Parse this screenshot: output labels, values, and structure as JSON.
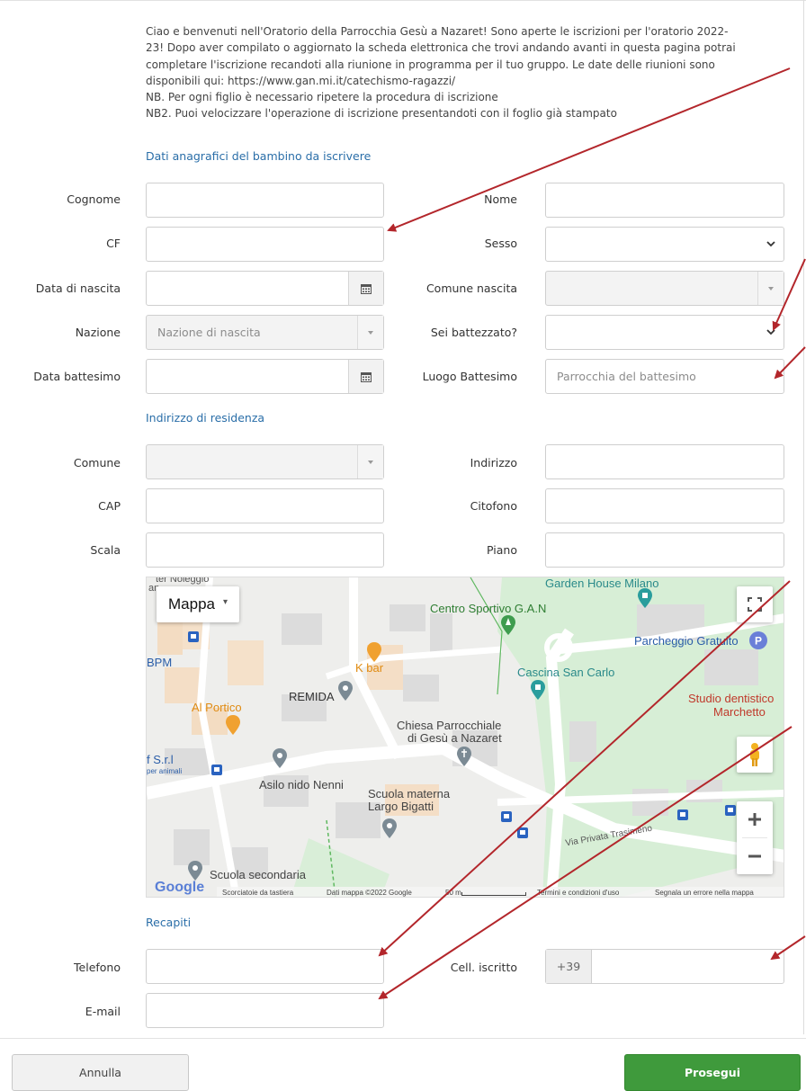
{
  "intro": {
    "lines": [
      "Ciao e benvenuti nell'Oratorio della Parrocchia Gesù a Nazaret! Sono aperte le iscrizioni per l'oratorio 2022-",
      "23! Dopo aver compilato o aggiornato la scheda elettronica che trovi andando avanti in questa pagina potrai",
      "completare l'iscrizione recandoti alla riunione in programma per il tuo gruppo. Le date delle riunioni sono",
      "disponibili qui: https://www.gan.mi.it/catechismo-ragazzi/",
      "NB. Per ogni figlio è necessario ripetere la procedura di iscrizione",
      "NB2. Puoi velocizzare l'operazione di iscrizione presentandoti con il foglio già stampato"
    ]
  },
  "sections": {
    "child": "Dati anagrafici del bambino da iscrivere",
    "address": "Indirizzo di residenza",
    "contacts": "Recapiti"
  },
  "labels": {
    "cognome": "Cognome",
    "nome": "Nome",
    "cf": "CF",
    "sesso": "Sesso",
    "data_nascita": "Data di nascita",
    "comune_nascita": "Comune nascita",
    "nazione": "Nazione",
    "battezzato": "Sei battezzato?",
    "data_battesimo": "Data battesimo",
    "luogo_battesimo": "Luogo Battesimo",
    "comune": "Comune",
    "indirizzo": "Indirizzo",
    "cap": "CAP",
    "citofono": "Citofono",
    "scala": "Scala",
    "piano": "Piano",
    "telefono": "Telefono",
    "cell": "Cell. iscritto",
    "email": "E-mail"
  },
  "placeholders": {
    "nazione": "Nazione di nascita",
    "luogo_battesimo": "Parrocchia del battesimo",
    "cell_prefix": "+39"
  },
  "map": {
    "type_button": "Mappa",
    "places": {
      "noleggio": "ter Noleggio",
      "an": "an",
      "bpm": "BPM",
      "kbar": "K bar",
      "remida": "REMIDA",
      "portico": "Al Portico",
      "srl": "f S.r.l",
      "per_animali": "per animali",
      "asilo": "Asilo nido Nenni",
      "chiesa1": "Chiesa Parrocchiale",
      "chiesa2": "di Gesù a Nazaret",
      "scuola_materna1": "Scuola materna",
      "scuola_materna2": "Largo Bigatti",
      "scuola_secondaria": "Scuola secondaria",
      "centro": "Centro Sportivo G.A.N",
      "garden": "Garden House Milano",
      "cascina": "Cascina San Carlo",
      "parcheggio": "Parcheggio Gratuito",
      "studio1": "Studio dentistico",
      "studio2": "Marchetto",
      "via": "Via Privata Trasimeno"
    },
    "footer": {
      "google": "Google",
      "shortcuts": "Scorciatoie da tastiera",
      "data": "Dati mappa ©2022 Google",
      "scale": "50 m",
      "terms": "Termini e condizioni d'uso",
      "report": "Segnala un errore nella mappa"
    }
  },
  "buttons": {
    "cancel": "Annulla",
    "next": "Prosegui"
  },
  "colors": {
    "section": "#2a6ea8",
    "next_button": "#3f9a3c",
    "annotation_arrow": "#b3262b"
  }
}
